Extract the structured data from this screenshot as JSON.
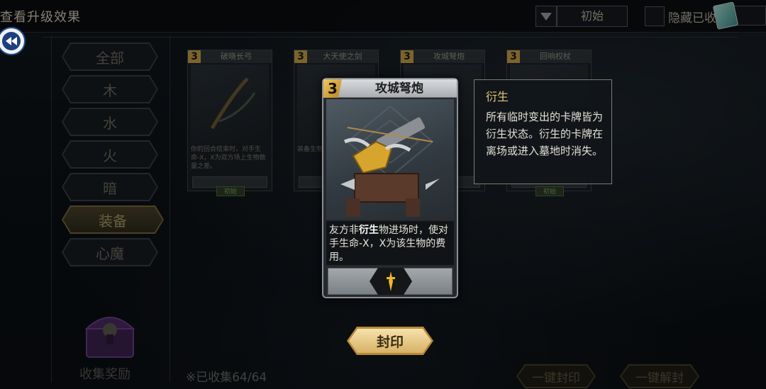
{
  "header": {
    "title": "查看升级效果",
    "filter_value": "初始",
    "hide_collected_label": "隐藏已收"
  },
  "categories": [
    {
      "label": "全部",
      "active": false
    },
    {
      "label": "木",
      "active": false
    },
    {
      "label": "水",
      "active": false
    },
    {
      "label": "火",
      "active": false
    },
    {
      "label": "暗",
      "active": false
    },
    {
      "label": "装备",
      "active": true
    },
    {
      "label": "心魔",
      "active": false
    }
  ],
  "grid_cards": [
    {
      "cost": "3",
      "name": "破晓长弓",
      "desc": "你的回合结束时，对手生命-X，X为双方场上生物数量之差。",
      "tag": "初始"
    },
    {
      "cost": "3",
      "name": "大天使之剑",
      "desc": "装备生物...",
      "tag": ""
    },
    {
      "cost": "3",
      "name": "攻城弩炮",
      "desc": "...时，X为...",
      "tag": ""
    },
    {
      "cost": "3",
      "name": "回响权杖",
      "desc": "",
      "tag": "初始"
    }
  ],
  "featured_card": {
    "cost": "3",
    "name": "攻城弩炮",
    "desc_prefix": "友方非",
    "desc_keyword": "衍生",
    "desc_suffix": "物进场时，使对手生命-X，X为该生物的费用。"
  },
  "tooltip": {
    "title": "衍生",
    "body": "所有临时变出的卡牌皆为衍生状态。衍生的卡牌在离场或进入墓地时消失。"
  },
  "buttons": {
    "seal": "封印",
    "seal_all": "一键封印",
    "unseal_all": "一键解封"
  },
  "footer": {
    "reward_label": "收集奖励",
    "collected_text": "※已收集64/64"
  },
  "colors": {
    "accent_gold": "#d7b266",
    "tooltip_title": "#e3c77a",
    "cost_badge": "#f2c660"
  }
}
